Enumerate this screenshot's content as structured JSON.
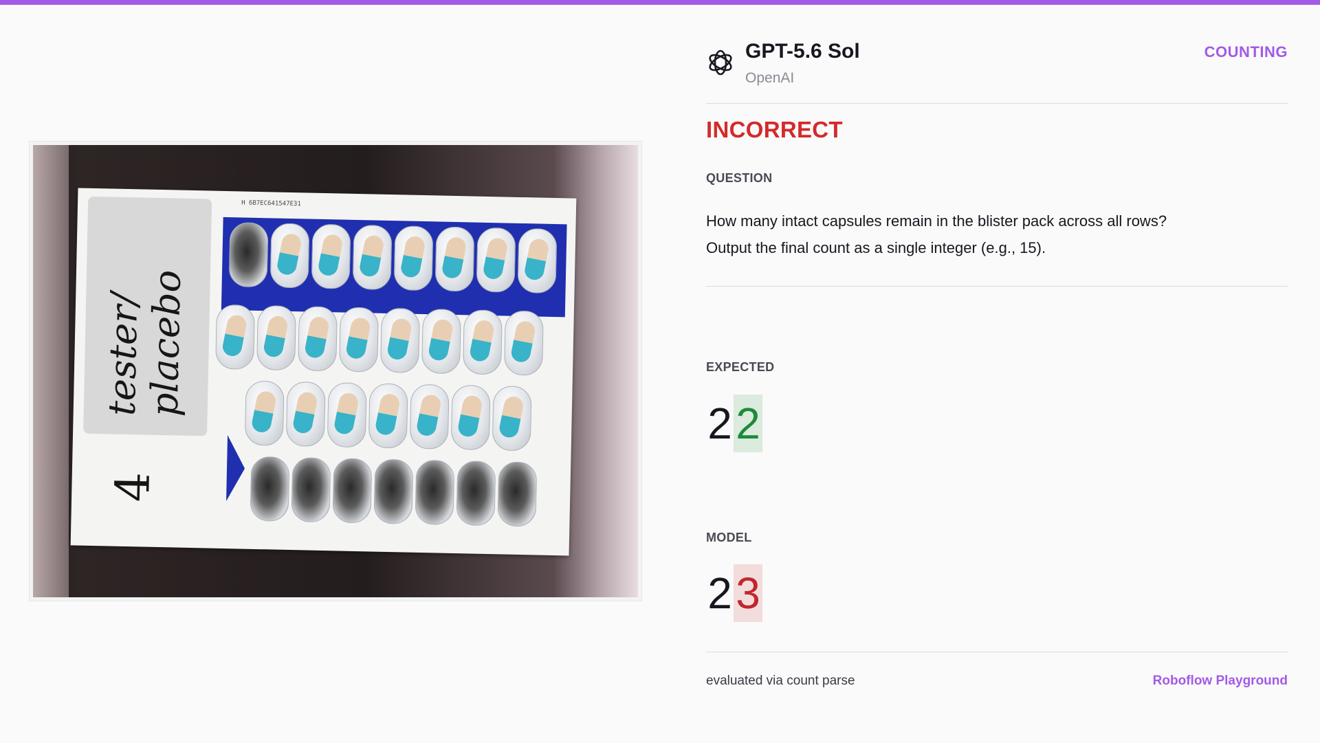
{
  "header": {
    "model_name": "GPT-5.6 Sol",
    "provider": "OpenAI",
    "category": "COUNTING",
    "icon": "openai-logo-icon"
  },
  "result": {
    "verdict": "INCORRECT",
    "verdict_color": "#d42a2a"
  },
  "question": {
    "label": "QUESTION",
    "text": "How many intact capsules remain in the blister pack across all rows? Output the final count as a single integer (e.g., 15)."
  },
  "expected": {
    "label": "EXPECTED",
    "prefix": "2",
    "diff": "2"
  },
  "model_answer": {
    "label": "MODEL",
    "prefix": "2",
    "diff": "3"
  },
  "footer": {
    "note": "evaluated via count parse",
    "link": "Roboflow Playground"
  },
  "image": {
    "label_text": "tester/ placebo",
    "card_number": "4",
    "code_text": "H 6B7EC641547E31"
  },
  "colors": {
    "accent": "#a35ae6",
    "incorrect": "#d42a2a",
    "correct_digit": "#1e8a3a",
    "wrong_digit": "#c0272d"
  }
}
